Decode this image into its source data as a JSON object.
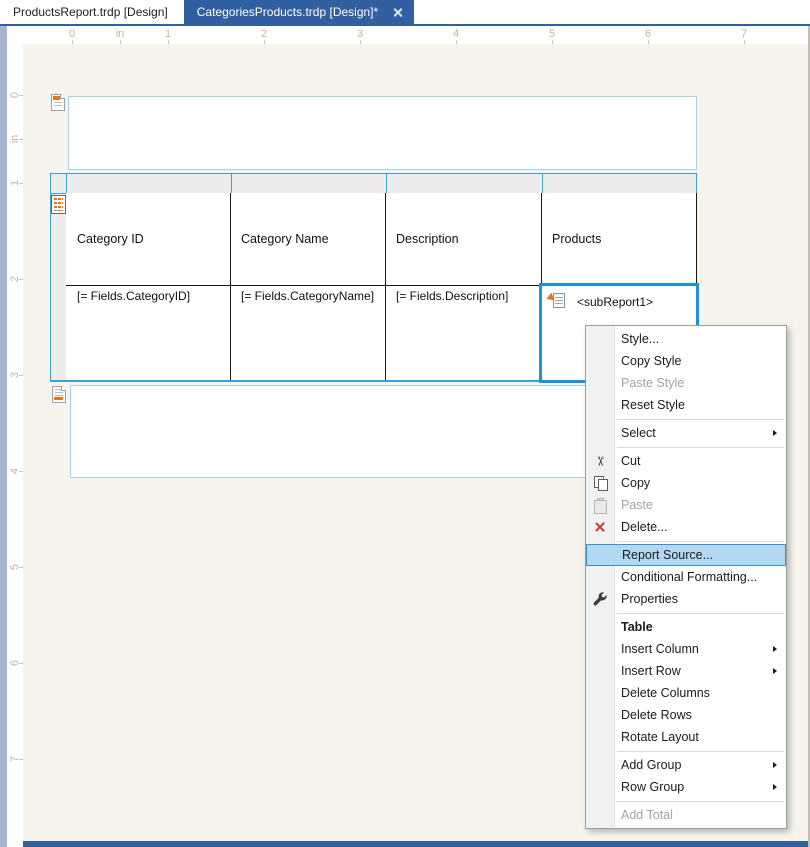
{
  "tabs": [
    {
      "label": "ProductsReport.trdp [Design]",
      "active": false
    },
    {
      "label": "CategoriesProducts.trdp [Design]*",
      "active": true,
      "close_glyph": ""
    }
  ],
  "ruler": {
    "unit": "in",
    "h_labels": [
      "0",
      "in",
      "1",
      "2",
      "3",
      "4",
      "5",
      "6",
      "7"
    ],
    "v_labels": [
      "0",
      "in",
      "1",
      "2",
      "3",
      "4",
      "5",
      "6",
      "7"
    ]
  },
  "design": {
    "bands": {
      "page_header": "page-header-section",
      "detail_table": "table-detail-section",
      "page_footer": "page-footer-section"
    },
    "table": {
      "header_cells": [
        "Category ID",
        "Category Name",
        "Description",
        "Products"
      ],
      "data_cells": [
        "[= Fields.CategoryID]",
        "[= Fields.CategoryName]",
        "[= Fields.Description]"
      ],
      "subreport_label": "<subReport1>"
    }
  },
  "context_menu": {
    "items": [
      {
        "id": "style",
        "label": "Style..."
      },
      {
        "id": "copy-style",
        "label": "Copy Style"
      },
      {
        "id": "paste-style",
        "label": "Paste Style",
        "disabled": true
      },
      {
        "id": "reset-style",
        "label": "Reset Style"
      },
      {
        "type": "separator"
      },
      {
        "id": "select",
        "label": "Select",
        "submenu": true
      },
      {
        "type": "separator"
      },
      {
        "id": "cut",
        "label": "Cut",
        "icon": "cut-icon"
      },
      {
        "id": "copy",
        "label": "Copy",
        "icon": "copy-icon"
      },
      {
        "id": "paste",
        "label": "Paste",
        "icon": "paste-icon",
        "disabled": true
      },
      {
        "id": "delete",
        "label": "Delete...",
        "icon": "delete-icon"
      },
      {
        "type": "separator"
      },
      {
        "id": "report-source",
        "label": "Report Source...",
        "highlighted": true
      },
      {
        "id": "conditional-formatting",
        "label": "Conditional Formatting..."
      },
      {
        "id": "properties",
        "label": "Properties",
        "icon": "wrench-icon"
      },
      {
        "type": "separator"
      },
      {
        "id": "table-header",
        "label": "Table",
        "header": true
      },
      {
        "id": "insert-column",
        "label": "Insert Column",
        "submenu": true
      },
      {
        "id": "insert-row",
        "label": "Insert Row",
        "submenu": true
      },
      {
        "id": "delete-columns",
        "label": "Delete Columns"
      },
      {
        "id": "delete-rows",
        "label": "Delete Rows"
      },
      {
        "id": "rotate-layout",
        "label": "Rotate Layout"
      },
      {
        "type": "separator"
      },
      {
        "id": "add-group",
        "label": "Add Group",
        "submenu": true
      },
      {
        "id": "row-group",
        "label": "Row Group",
        "submenu": true
      },
      {
        "type": "separator"
      },
      {
        "id": "add-total",
        "label": "Add Total",
        "disabled": true
      }
    ]
  },
  "colors": {
    "accent_blue": "#30609f",
    "selection_blue": "#1e93d7",
    "table_blue": "#3aa0d8",
    "band_border_blue": "#a9d1e4",
    "menu_highlight_fill": "#b3d8f1",
    "menu_highlight_border": "#3a8ed6",
    "icon_orange": "#e8731a",
    "delete_red": "#c23a2d",
    "surface_beige": "#f7f4ee",
    "left_strip_periwinkle": "#a9b4d1"
  }
}
